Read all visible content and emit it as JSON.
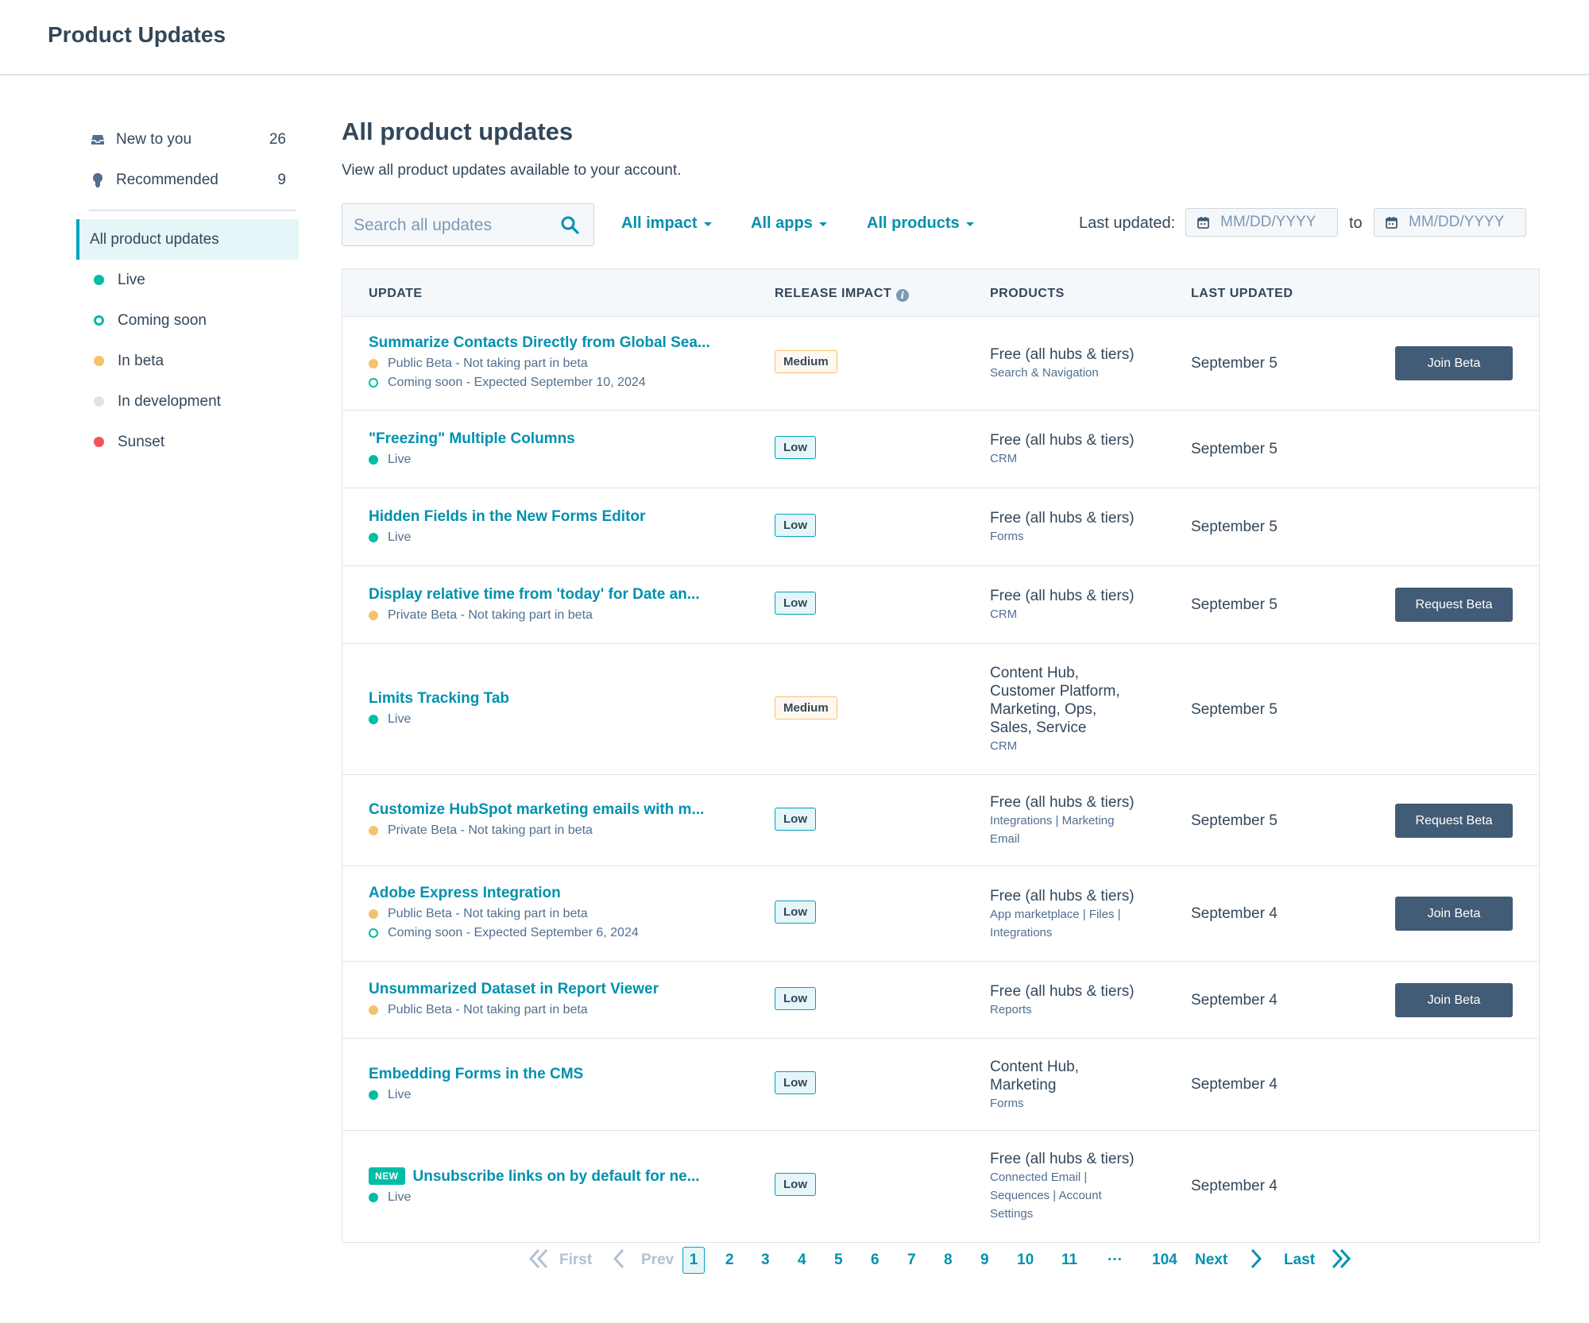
{
  "app": {
    "title": "Product Updates"
  },
  "sidebar": {
    "top_items": [
      {
        "label": "New to you",
        "count": "26",
        "icon": "inbox-icon"
      },
      {
        "label": "Recommended",
        "count": "9",
        "icon": "lightbulb-icon"
      }
    ],
    "active_item": "All product updates",
    "statuses": [
      {
        "label": "Live",
        "color": "#00bda5",
        "style": "filled"
      },
      {
        "label": "Coming soon",
        "color": "#00bda5",
        "style": "ring"
      },
      {
        "label": "In beta",
        "color": "#f5c26b",
        "style": "filled"
      },
      {
        "label": "In development",
        "color": "#dfe3eb",
        "style": "filled"
      },
      {
        "label": "Sunset",
        "color": "#f2545b",
        "style": "filled"
      }
    ]
  },
  "main": {
    "heading": "All product updates",
    "subtitle": "View all product updates available to your account."
  },
  "filters": {
    "search_placeholder": "Search all updates",
    "impact": "All impact",
    "apps": "All apps",
    "products": "All products",
    "last_updated_label": "Last updated:",
    "date_placeholder": "MM/DD/YYYY",
    "to_label": "to"
  },
  "table": {
    "headers": {
      "update": "UPDATE",
      "impact": "RELEASE IMPACT",
      "products": "PRODUCTS",
      "last_updated": "LAST UPDATED"
    },
    "rows": [
      {
        "title": "Summarize Contacts Directly from Global Sea...",
        "is_new": false,
        "statuses": [
          {
            "text": "Public Beta - Not taking part in beta",
            "color": "#f5c26b",
            "style": "filled"
          },
          {
            "text": "Coming soon - Expected September 10, 2024",
            "color": "#00bda5",
            "style": "ring"
          }
        ],
        "impact": "Medium",
        "products_main": [
          "Free (all hubs & tiers)"
        ],
        "products_sub": [
          "Search & Navigation"
        ],
        "date": "September 5",
        "action": "Join Beta"
      },
      {
        "title": "\"Freezing\" Multiple Columns",
        "is_new": false,
        "statuses": [
          {
            "text": "Live",
            "color": "#00bda5",
            "style": "filled"
          }
        ],
        "impact": "Low",
        "products_main": [
          "Free (all hubs & tiers)"
        ],
        "products_sub": [
          "CRM"
        ],
        "date": "September 5",
        "action": ""
      },
      {
        "title": "Hidden Fields in the New Forms Editor",
        "is_new": false,
        "statuses": [
          {
            "text": "Live",
            "color": "#00bda5",
            "style": "filled"
          }
        ],
        "impact": "Low",
        "products_main": [
          "Free (all hubs & tiers)"
        ],
        "products_sub": [
          "Forms"
        ],
        "date": "September 5",
        "action": ""
      },
      {
        "title": "Display relative time from 'today' for Date an...",
        "is_new": false,
        "statuses": [
          {
            "text": "Private Beta - Not taking part in beta",
            "color": "#f5c26b",
            "style": "filled"
          }
        ],
        "impact": "Low",
        "products_main": [
          "Free (all hubs & tiers)"
        ],
        "products_sub": [
          "CRM"
        ],
        "date": "September 5",
        "action": "Request Beta"
      },
      {
        "title": "Limits Tracking Tab",
        "is_new": false,
        "statuses": [
          {
            "text": "Live",
            "color": "#00bda5",
            "style": "filled"
          }
        ],
        "impact": "Medium",
        "products_main": [
          "Content Hub,",
          "Customer Platform,",
          "Marketing, Ops,",
          "Sales, Service"
        ],
        "products_sub": [
          "CRM"
        ],
        "date": "September 5",
        "action": ""
      },
      {
        "title": "Customize HubSpot marketing emails with m...",
        "is_new": false,
        "statuses": [
          {
            "text": "Private Beta - Not taking part in beta",
            "color": "#f5c26b",
            "style": "filled"
          }
        ],
        "impact": "Low",
        "products_main": [
          "Free (all hubs & tiers)"
        ],
        "products_sub": [
          "Integrations | Marketing",
          "Email"
        ],
        "date": "September 5",
        "action": "Request Beta"
      },
      {
        "title": "Adobe Express Integration",
        "is_new": false,
        "statuses": [
          {
            "text": "Public Beta - Not taking part in beta",
            "color": "#f5c26b",
            "style": "filled"
          },
          {
            "text": "Coming soon - Expected September 6, 2024",
            "color": "#00bda5",
            "style": "ring"
          }
        ],
        "impact": "Low",
        "products_main": [
          "Free (all hubs & tiers)"
        ],
        "products_sub": [
          "App marketplace | Files |",
          "Integrations"
        ],
        "date": "September 4",
        "action": "Join Beta"
      },
      {
        "title": "Unsummarized Dataset in Report Viewer",
        "is_new": false,
        "statuses": [
          {
            "text": "Public Beta - Not taking part in beta",
            "color": "#f5c26b",
            "style": "filled"
          }
        ],
        "impact": "Low",
        "products_main": [
          "Free (all hubs & tiers)"
        ],
        "products_sub": [
          "Reports"
        ],
        "date": "September 4",
        "action": "Join Beta"
      },
      {
        "title": "Embedding Forms in the CMS",
        "is_new": false,
        "statuses": [
          {
            "text": "Live",
            "color": "#00bda5",
            "style": "filled"
          }
        ],
        "impact": "Low",
        "products_main": [
          "Content Hub,",
          "Marketing"
        ],
        "products_sub": [
          "Forms"
        ],
        "date": "September 4",
        "action": ""
      },
      {
        "title": "Unsubscribe links on by default for ne...",
        "is_new": true,
        "new_label": "NEW",
        "statuses": [
          {
            "text": "Live",
            "color": "#00bda5",
            "style": "filled"
          }
        ],
        "impact": "Low",
        "products_main": [
          "Free (all hubs & tiers)"
        ],
        "products_sub": [
          "Connected Email |",
          "Sequences | Account",
          "Settings"
        ],
        "date": "September 4",
        "action": ""
      }
    ]
  },
  "pagination": {
    "first": "First",
    "prev": "Prev",
    "current": "1",
    "pages": [
      "2",
      "3",
      "4",
      "5",
      "6",
      "7",
      "8",
      "9",
      "10",
      "11"
    ],
    "ellipsis": "···",
    "last_page": "104",
    "next": "Next",
    "last": "Last"
  }
}
